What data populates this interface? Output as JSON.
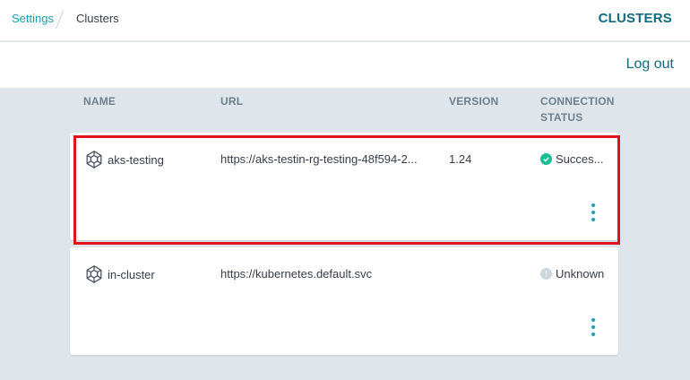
{
  "breadcrumb": {
    "parent": "Settings",
    "current": "Clusters"
  },
  "header": {
    "title": "CLUSTERS",
    "logout": "Log out"
  },
  "table": {
    "columns": {
      "name": "NAME",
      "url": "URL",
      "version": "VERSION",
      "status_line1": "CONNECTION",
      "status_line2": "STATUS"
    },
    "rows": [
      {
        "name": "aks-testing",
        "url": "https://aks-testin-rg-testing-48f594-2...",
        "version": "1.24",
        "status": "Succes...",
        "status_icon": "check-circle-icon",
        "status_color": "#18be94",
        "selected": true
      },
      {
        "name": "in-cluster",
        "url": "https://kubernetes.default.svc",
        "version": "",
        "status": "Unknown",
        "status_icon": "question-circle-icon",
        "status_color": "#ccd6dd",
        "selected": false
      }
    ]
  },
  "colors": {
    "accent": "#0f6b7e",
    "link": "#1e9fb0",
    "background": "#dee6eb",
    "highlight": "#e0121c"
  }
}
